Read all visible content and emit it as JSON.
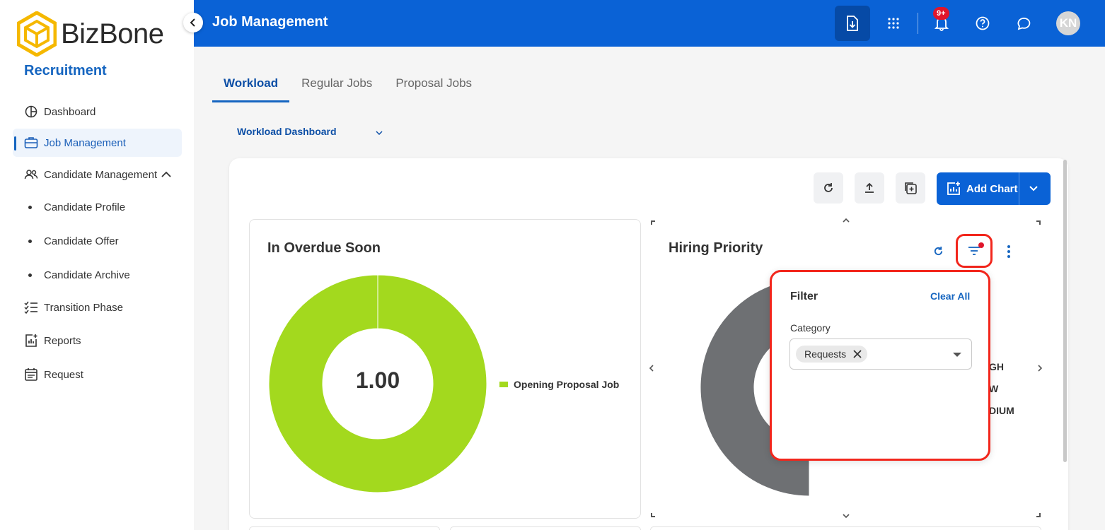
{
  "brand": {
    "name": "BizBone",
    "module": "Recruitment"
  },
  "header": {
    "title": "Job Management",
    "notification_badge": "9+",
    "avatar_initials": "KN"
  },
  "sidebar": {
    "items": [
      {
        "label": "Dashboard",
        "icon": "dashboard-icon"
      },
      {
        "label": "Job Management",
        "icon": "briefcase-icon",
        "active": true
      },
      {
        "label": "Candidate Management",
        "icon": "people-icon",
        "expanded": true
      },
      {
        "label": "Candidate Profile",
        "sub": true
      },
      {
        "label": "Candidate Offer",
        "sub": true
      },
      {
        "label": "Candidate Archive",
        "sub": true
      },
      {
        "label": "Transition Phase",
        "icon": "checklist-icon"
      },
      {
        "label": "Reports",
        "icon": "report-icon"
      },
      {
        "label": "Request",
        "icon": "calendar-icon"
      }
    ]
  },
  "tabs": [
    {
      "label": "Workload",
      "active": true
    },
    {
      "label": "Regular Jobs"
    },
    {
      "label": "Proposal Jobs"
    }
  ],
  "dashboard_selector": {
    "value": "Workload Dashboard"
  },
  "toolbar": {
    "add_chart_label": "Add Chart"
  },
  "widgets": {
    "overdue": {
      "title": "In Overdue Soon",
      "center_value": "1.00",
      "legend": [
        {
          "label": "Opening Proposal Job",
          "color": "#a3d91e"
        }
      ]
    },
    "hiring_priority": {
      "title": "Hiring Priority",
      "legend_partial": [
        "GH",
        "W",
        "DIUM"
      ]
    }
  },
  "filter_popover": {
    "title": "Filter",
    "clear_all_label": "Clear All",
    "category_label": "Category",
    "selected_chips": [
      "Requests"
    ]
  },
  "chart_data": [
    {
      "type": "pie",
      "title": "In Overdue Soon",
      "categories": [
        "Opening Proposal Job"
      ],
      "values": [
        1.0
      ],
      "colors": [
        "#a3d91e"
      ]
    },
    {
      "type": "pie",
      "title": "Hiring Priority",
      "categories": [
        "",
        "",
        ""
      ],
      "values": [
        0.52,
        0.03,
        0.16
      ],
      "colors": [
        "#6e7073",
        "#8fd41a",
        "#e08540"
      ]
    }
  ],
  "colors": {
    "primary": "#0a62d6",
    "accent_red": "#f2261c",
    "chart_green": "#a3d91e"
  }
}
